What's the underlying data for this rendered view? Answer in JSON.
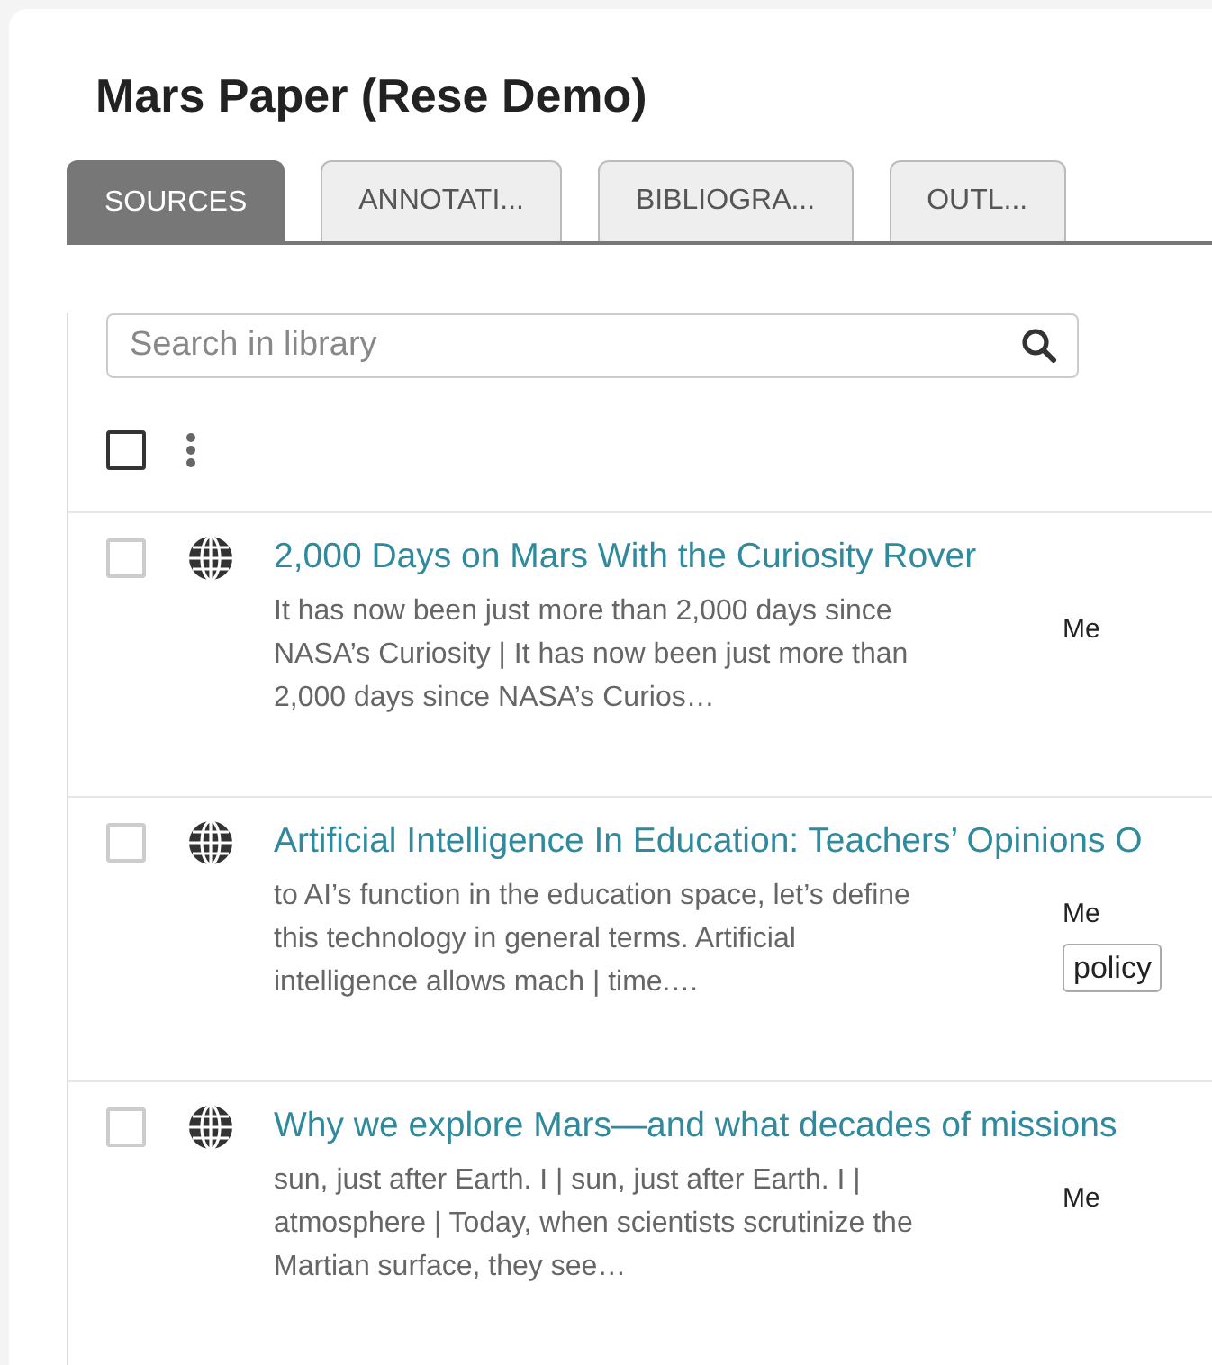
{
  "title": "Mars Paper (Rese Demo)",
  "tabs": [
    {
      "label": "SOURCES",
      "selected": true
    },
    {
      "label": "ANNOTATI...",
      "selected": false
    },
    {
      "label": "BIBLIOGRA...",
      "selected": false
    },
    {
      "label": "OUTL...",
      "selected": false
    }
  ],
  "search": {
    "placeholder": "Search in library"
  },
  "select_all": {
    "checked": false
  },
  "sources": [
    {
      "title": "2,000 Days on Mars With the Curiosity Rover",
      "snippet": "It has now been just more than 2,000 days since NASA’s Curiosity | It has now been just more than 2,000 days since NASA’s Curios…",
      "owner": "Me",
      "checked": false
    },
    {
      "title": "Artificial Intelligence In Education: Teachers’ Opinions O",
      "snippet": "to AI’s function in the education space, let’s define this technology in general terms. Artificial intelligence allows mach | time.…",
      "owner": "Me",
      "tags": [
        "policy"
      ],
      "checked": false
    },
    {
      "title": "Why we explore Mars—and what decades of missions",
      "snippet": "sun, just after Earth. I | sun, just after Earth. I | atmosphere | Today, when scientists scrutinize the Martian surface, they see…",
      "owner": "Me",
      "checked": false
    }
  ]
}
